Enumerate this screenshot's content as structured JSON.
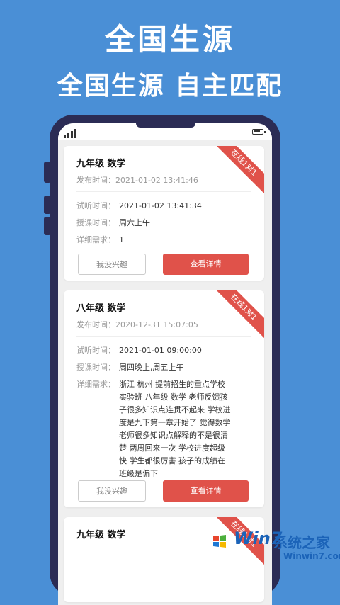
{
  "header": {
    "title": "全国生源",
    "subtitle": "全国生源  自主匹配"
  },
  "labels": {
    "publish": "发布时间：",
    "trial": "试听时间：",
    "teach": "授课时间：",
    "detail": "详细需求："
  },
  "cards": [
    {
      "ribbon": "在线1对1",
      "title": "九年级 数学",
      "publish_time": "2021-01-02 13:41:46",
      "trial_time": "2021-01-02 13:41:34",
      "teach_time": "周六上午",
      "detail": "1",
      "btn_ignore": "我没兴趣",
      "btn_detail": "查看详情"
    },
    {
      "ribbon": "在线1对1",
      "title": "八年级 数学",
      "publish_time": "2020-12-31 15:07:05",
      "trial_time": "2021-01-01 09:00:00",
      "teach_time": "周四晚上,周五上午",
      "detail": "浙江 杭州 提前招生的重点学校实验班 八年级 数学 老师反馈孩子很多知识点连贯不起来 学校进度是九下第一章开始了 觉得数学老师很多知识点解释的不是很清楚 两周回来一次 学校进度超级快 学生都很厉害 孩子的成绩在班级是偏下",
      "btn_ignore": "我没兴趣",
      "btn_detail": "查看详情"
    },
    {
      "ribbon": "在线1对1",
      "title": "九年级 数学"
    }
  ],
  "watermark": {
    "brand": "Win7",
    "text": "系统之家",
    "url": "Winwin7.com"
  }
}
